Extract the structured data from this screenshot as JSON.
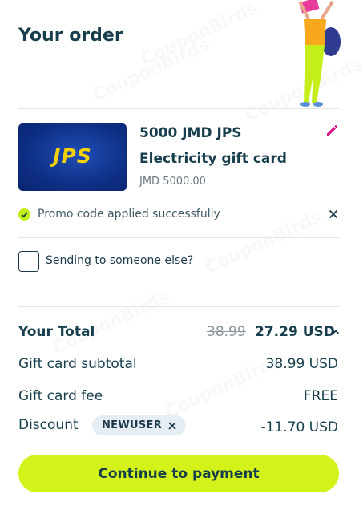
{
  "header": {
    "title": "Your order"
  },
  "product": {
    "image_logo": "JPS",
    "title": "5000 JMD JPS",
    "subtitle": "Electricity gift card",
    "price": "JMD 5000.00"
  },
  "promo": {
    "message": "Promo code applied successfully"
  },
  "recipient": {
    "checkbox_label": "Sending to someone else?",
    "checked": false
  },
  "summary": {
    "total_label": "Your Total",
    "total_original": "38.99",
    "total_value": "27.29 USD",
    "subtotal_label": "Gift card subtotal",
    "subtotal_value": "38.99 USD",
    "fee_label": "Gift card fee",
    "fee_value": "FREE",
    "discount_label": "Discount",
    "discount_code": "NEWUSER",
    "discount_value": "-11.70 USD"
  },
  "cta": {
    "label": "Continue to payment"
  },
  "watermark": "CouponBirds",
  "colors": {
    "accent": "#d2f21a",
    "text": "#163e4c",
    "edit": "#d41a8c",
    "card_bg": "#0e2f85",
    "card_logo": "#f5d10a"
  }
}
